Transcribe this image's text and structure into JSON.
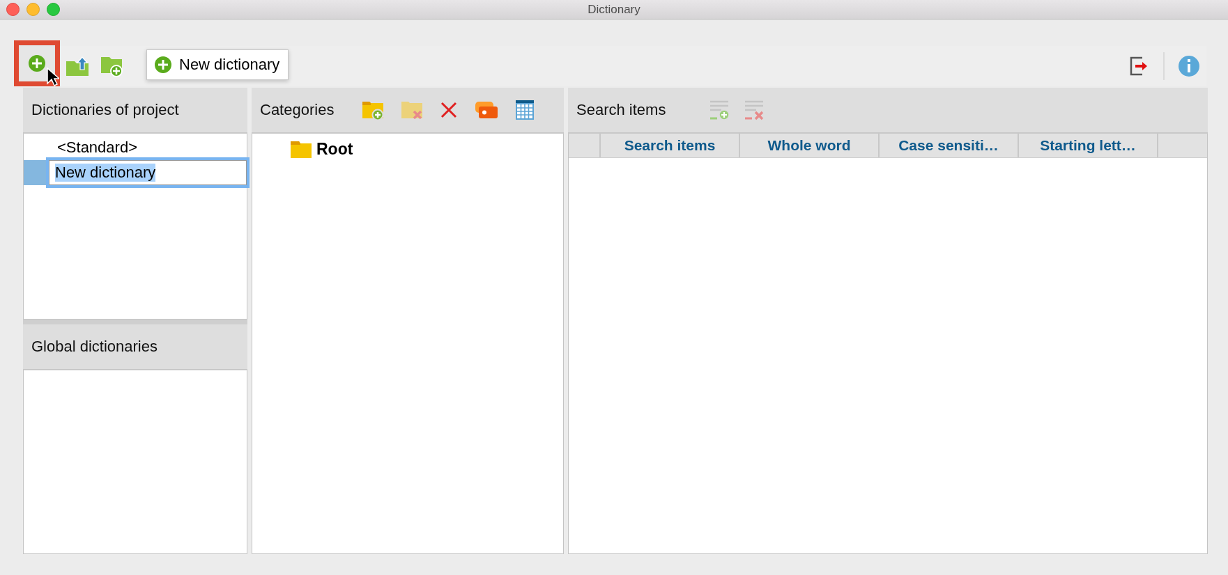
{
  "window": {
    "title": "Dictionary"
  },
  "toolbar": {
    "tooltip": "New dictionary"
  },
  "project_dictionaries": {
    "title": "Dictionaries of project",
    "items": [
      {
        "label": "<Standard>",
        "kind": "text",
        "selected": false
      },
      {
        "label": "New dictionary",
        "kind": "editing",
        "selected": true
      }
    ]
  },
  "global_dictionaries": {
    "title": "Global dictionaries"
  },
  "categories": {
    "title": "Categories",
    "tree": [
      {
        "label": "Root"
      }
    ]
  },
  "search_items": {
    "title": "Search items",
    "columns": [
      "Search items",
      "Whole word",
      "Case sensiti…",
      "Starting lett…"
    ]
  }
}
